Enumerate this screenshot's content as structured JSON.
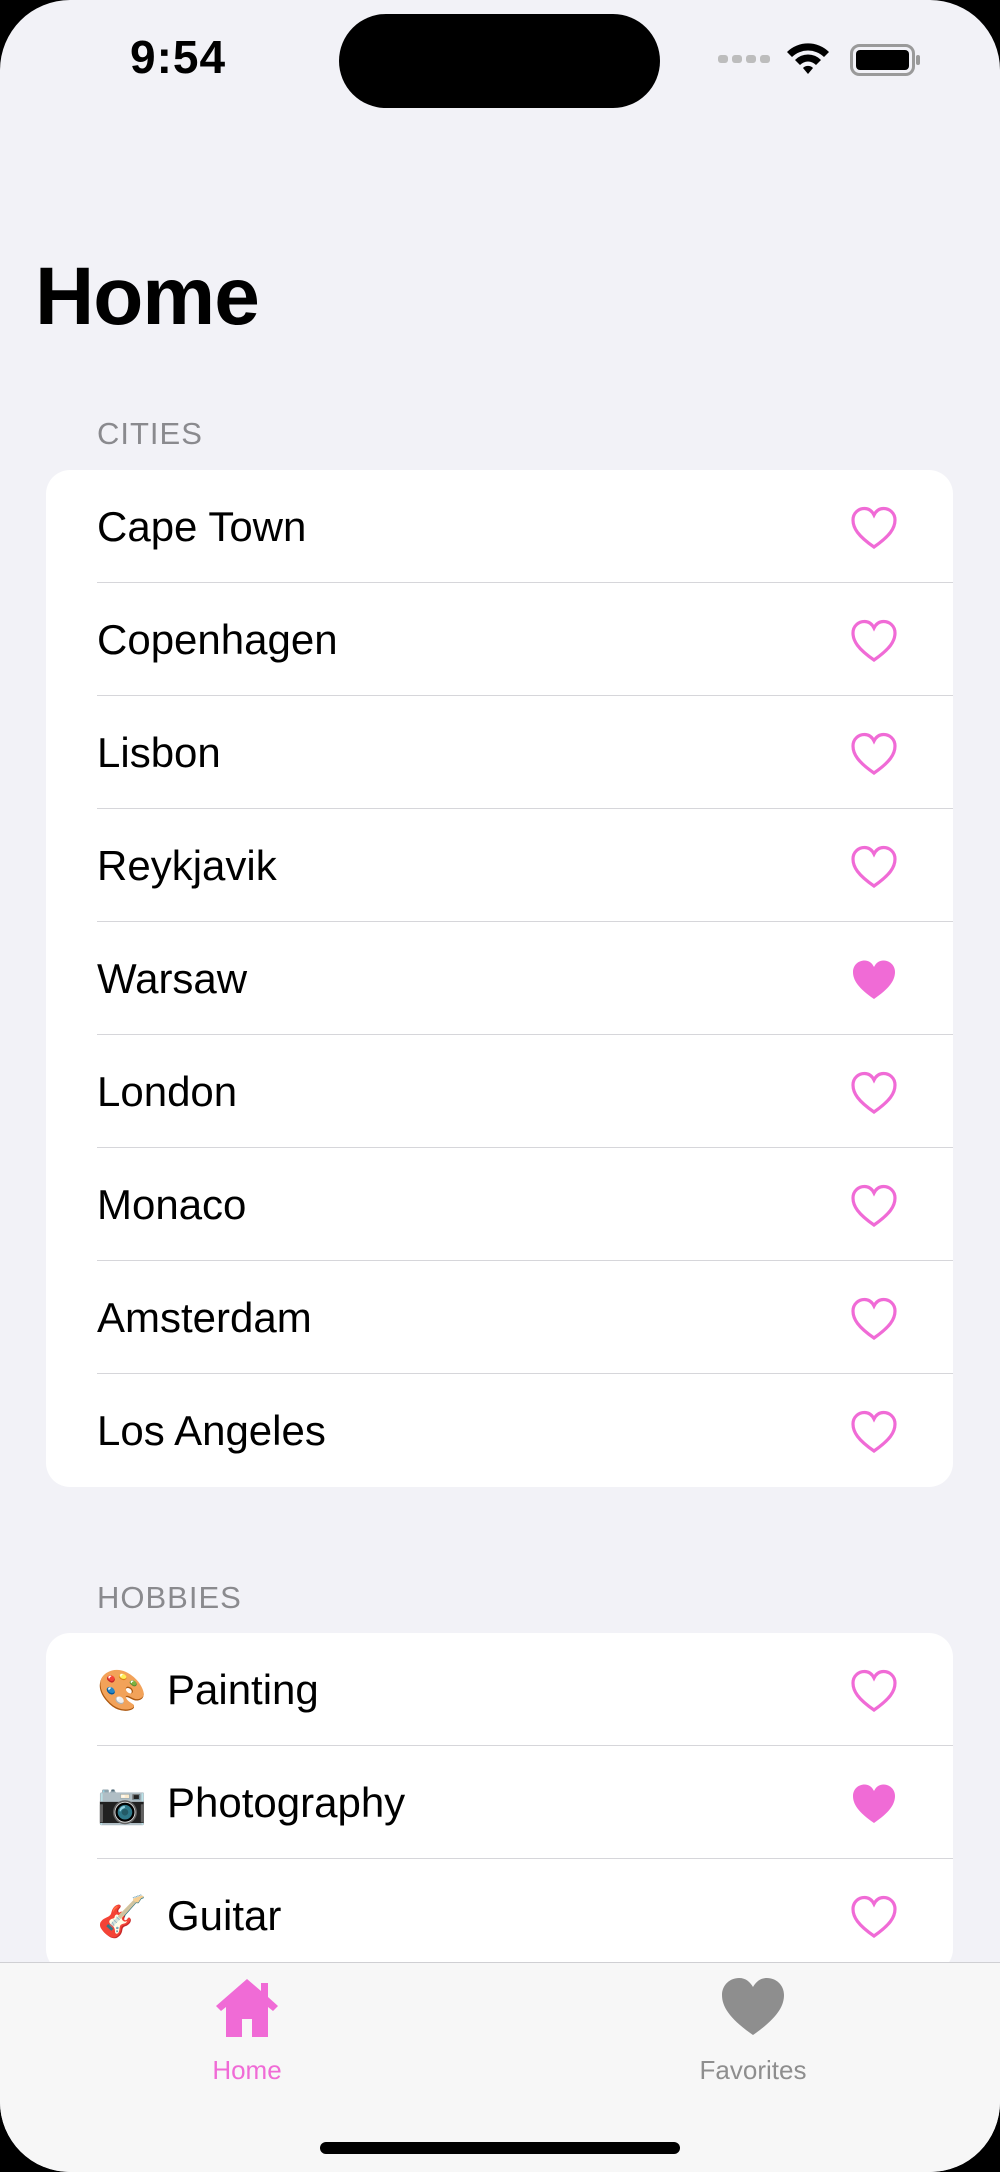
{
  "status_bar": {
    "time": "9:54"
  },
  "title": "Home",
  "colors": {
    "accent": "#f06bd6",
    "inactive": "#8e8e8e",
    "background": "#f2f2f7"
  },
  "cities": {
    "header": "CITIES",
    "items": [
      {
        "label": "Cape Town",
        "favorite": false
      },
      {
        "label": "Copenhagen",
        "favorite": false
      },
      {
        "label": "Lisbon",
        "favorite": false
      },
      {
        "label": "Reykjavik",
        "favorite": false
      },
      {
        "label": "Warsaw",
        "favorite": true
      },
      {
        "label": "London",
        "favorite": false
      },
      {
        "label": "Monaco",
        "favorite": false
      },
      {
        "label": "Amsterdam",
        "favorite": false
      },
      {
        "label": "Los Angeles",
        "favorite": false
      }
    ]
  },
  "hobbies": {
    "header": "HOBBIES",
    "items": [
      {
        "emoji": "🎨",
        "label": "Painting",
        "favorite": false
      },
      {
        "emoji": "📷",
        "label": "Photography",
        "favorite": true
      },
      {
        "emoji": "🎸",
        "label": "Guitar",
        "favorite": false
      }
    ]
  },
  "tabs": [
    {
      "label": "Home",
      "icon": "house-icon",
      "selected": true
    },
    {
      "label": "Favorites",
      "icon": "heart-icon",
      "selected": false
    }
  ]
}
